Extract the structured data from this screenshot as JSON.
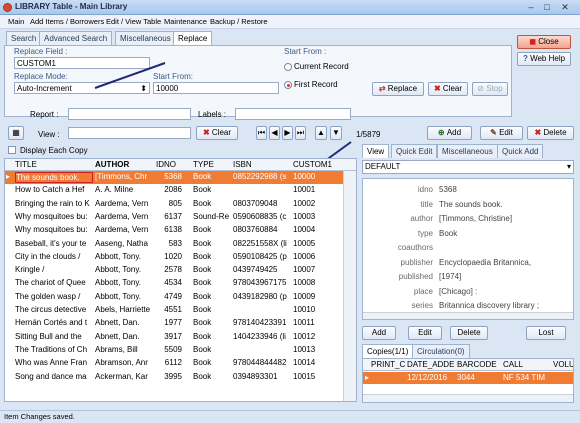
{
  "window": {
    "title": "LIBRARY Table - Main Library"
  },
  "menu": [
    "Main",
    "Add Items / Borrowers",
    "Edit / View Table",
    "Maintenance",
    "Backup / Restore"
  ],
  "tabs": [
    "Search",
    "Advanced Search",
    "Miscellaneous",
    "Replace"
  ],
  "replace": {
    "field_label": "Replace Field :",
    "field_value": "CUSTOM1",
    "mode_label": "Replace Mode:",
    "mode_value": "Auto-Increment",
    "start_label": "Start From:",
    "start_value": "10000",
    "start_from_label": "Start From :",
    "opt1": "Current Record",
    "opt2": "First Record",
    "replace_btn": "Replace",
    "clear_btn": "Clear",
    "stop_btn": "Stop"
  },
  "side": {
    "close": "Close",
    "help": "Web Help"
  },
  "filters": {
    "report": "Report :",
    "labels": "Labels :",
    "view": "View :",
    "clear": "Clear",
    "counter": "1/5879",
    "add": "Add",
    "edit": "Edit",
    "delete": "Delete"
  },
  "display_each": "Display Each Copy",
  "grid": {
    "headers": [
      "TITLE",
      "AUTHOR",
      "IDNO",
      "TYPE",
      "ISBN",
      "CUSTOM1"
    ],
    "rows": [
      [
        "The sounds book.",
        "[Timmons, Chr",
        "5368",
        "Book",
        "0852292988 (s",
        "10000"
      ],
      [
        "How to Catch a Hef",
        "A. A. Milne",
        "2086",
        "Book",
        "",
        "10001"
      ],
      [
        "Bringing the rain to K",
        "Aardema, Vern",
        "805",
        "Book",
        "0803709048",
        "10002"
      ],
      [
        "Why mosquitoes bu:",
        "Aardema, Vern",
        "6137",
        "Sound-Re",
        "0590608835 (c",
        "10003"
      ],
      [
        "Why mosquitoes bu:",
        "Aardema, Vern",
        "6138",
        "Book",
        "0803760884",
        "10004"
      ],
      [
        "Baseball, it's your te",
        "Aaseng, Natha",
        "583",
        "Book",
        "082251558X (li",
        "10005"
      ],
      [
        "City in the clouds /",
        "Abbott, Tony.",
        "1020",
        "Book",
        "0590108425 (p",
        "10006"
      ],
      [
        "Kringle /",
        "Abbott, Tony.",
        "2578",
        "Book",
        "0439749425",
        "10007"
      ],
      [
        "The chariot of Quee",
        "Abbott, Tony.",
        "4534",
        "Book",
        "978043967175",
        "10008"
      ],
      [
        "The golden wasp /",
        "Abbott, Tony.",
        "4749",
        "Book",
        "0439182980 (p",
        "10009"
      ],
      [
        "The circus detective",
        "Abels, Harriette",
        "4551",
        "Book",
        "",
        "10010"
      ],
      [
        "Hernán Cortés and t",
        "Abnett, Dan.",
        "1977",
        "Book",
        "978140423391",
        "10011"
      ],
      [
        "Sitting Bull and the",
        "Abnett, Dan.",
        "3917",
        "Book",
        "1404233946 (li",
        "10012"
      ],
      [
        "The Traditions of Ch",
        "Abrams, Bill",
        "5509",
        "Book",
        "",
        "10013"
      ],
      [
        "Who was Anne Fran",
        "Abramson, Anr",
        "6112",
        "Book",
        "978044844482",
        "10014"
      ],
      [
        "Song and dance ma",
        "Ackerman, Kar",
        "3995",
        "Book",
        "0394893301",
        "10015"
      ]
    ]
  },
  "detail_tabs": [
    "View",
    "Quick Edit",
    "Miscellaneous",
    "Quick Add"
  ],
  "detail_select": "DEFAULT",
  "details": [
    [
      "idno",
      "5368"
    ],
    [
      "title",
      "The sounds book."
    ],
    [
      "author",
      "[Timmons, Christine]"
    ],
    [
      "type",
      "Book"
    ],
    [
      "coauthors",
      ""
    ],
    [
      "publisher",
      "Encyclopaedia Britannica,"
    ],
    [
      "published",
      "[1974]"
    ],
    [
      "place",
      "[Chicago] :"
    ],
    [
      "series",
      "Britannica discovery library ;"
    ]
  ],
  "copy_buttons": [
    "Add",
    "Edit",
    "Delete",
    "Lost"
  ],
  "copy_tabs": [
    "Copies(1/1)",
    "Circulation(0)"
  ],
  "copy_headers": [
    "PRINT_C",
    "DATE_ADDE",
    "BARCODE",
    "CALL",
    "VOLU"
  ],
  "copy_row": [
    "",
    "12/12/2016",
    "3044",
    "NF 534 TIM",
    ""
  ],
  "status": "Item Changes saved."
}
